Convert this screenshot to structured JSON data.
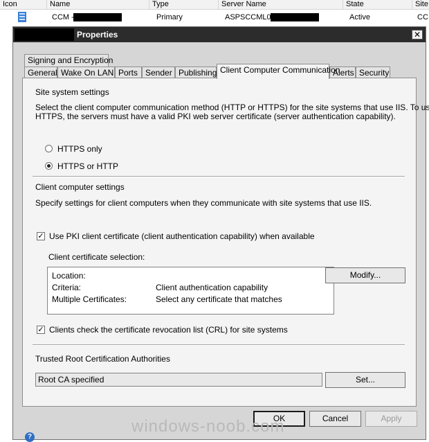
{
  "list": {
    "columns": [
      "Icon",
      "Name",
      "Type",
      "Server Name",
      "State",
      "Site"
    ],
    "row": {
      "icon": "server-icon",
      "name": "CCM -",
      "type": "Primary",
      "server_name": "ASPSCCML01",
      "state": "Active",
      "site": "CC"
    }
  },
  "dialog": {
    "title": "Properties",
    "close_glyph": "✕",
    "tabs_top": [
      "Signing and Encryption"
    ],
    "tabs": [
      "General",
      "Wake On LAN",
      "Ports",
      "Sender",
      "Publishing",
      "Client Computer Communication",
      "Alerts",
      "Security"
    ],
    "active_tab": "Client Computer Communication",
    "site_system": {
      "heading": "Site system settings",
      "description_line1": "Select the client computer communication method (HTTP or HTTPS) for the site systems that use IIS. To use",
      "description_line2": "HTTPS, the servers must have a valid PKI web server certificate (server authentication capability).",
      "option_https_only": "HTTPS only",
      "option_https_or_http": "HTTPS or HTTP",
      "selected": "HTTPS or HTTP"
    },
    "client_computer": {
      "heading": "Client computer settings",
      "description": "Specify settings for client computers when they communicate with site systems that use IIS.",
      "use_pki_label": "Use PKI client certificate (client authentication capability) when available",
      "use_pki_checked": true,
      "cert_selection_label": "Client certificate selection:",
      "cert_rows": [
        {
          "label": "Location:",
          "value": ""
        },
        {
          "label": "Criteria:",
          "value": "Client authentication capability"
        },
        {
          "label": "Multiple Certificates:",
          "value": "Select any certificate that matches"
        }
      ],
      "modify_button": "Modify...",
      "crl_label": "Clients check the certificate revocation list (CRL) for site systems",
      "crl_checked": true
    },
    "trusted_root": {
      "heading": "Trusted Root Certification Authorities",
      "value": "Root CA specified",
      "set_button": "Set..."
    },
    "buttons": {
      "ok": "OK",
      "cancel": "Cancel",
      "apply": "Apply",
      "help": "?"
    }
  },
  "watermark": "windows-noob.com",
  "colors": {
    "titlebar": "#2c2c2c",
    "dialog_bg": "#d6d6d6",
    "panel_bg": "#f4f4f4"
  }
}
